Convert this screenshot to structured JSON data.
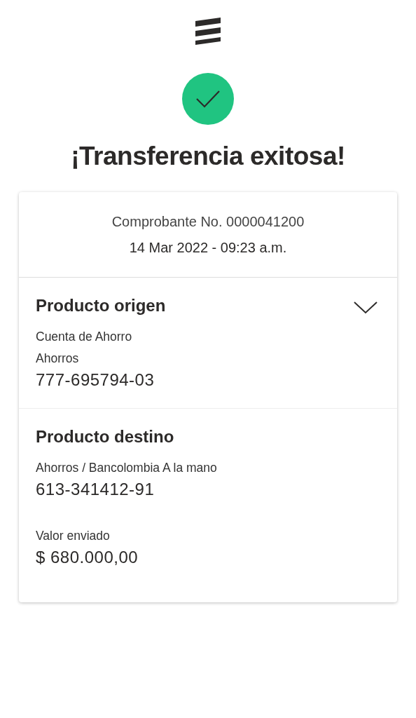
{
  "title": "¡Transferencia exitosa!",
  "receipt": {
    "number": "Comprobante No. 0000041200",
    "date": "14 Mar 2022 - 09:23 a.m."
  },
  "sections": [
    {
      "heading": "Producto origen",
      "expanded": false,
      "lines": [
        {
          "kind": "label",
          "text": "Cuenta de Ahorro"
        },
        {
          "kind": "label",
          "text": "Ahorros"
        },
        {
          "kind": "value",
          "text": "777-695794-03"
        }
      ]
    },
    {
      "heading": "Producto destino",
      "lines": [
        {
          "kind": "label",
          "text": "Ahorros / Bancolombia A la mano"
        },
        {
          "kind": "value",
          "text": "613-341412-91"
        },
        {
          "kind": "gap"
        },
        {
          "kind": "label",
          "text": "Valor enviado"
        },
        {
          "kind": "value",
          "text": "$ 680.000,00"
        }
      ]
    }
  ]
}
